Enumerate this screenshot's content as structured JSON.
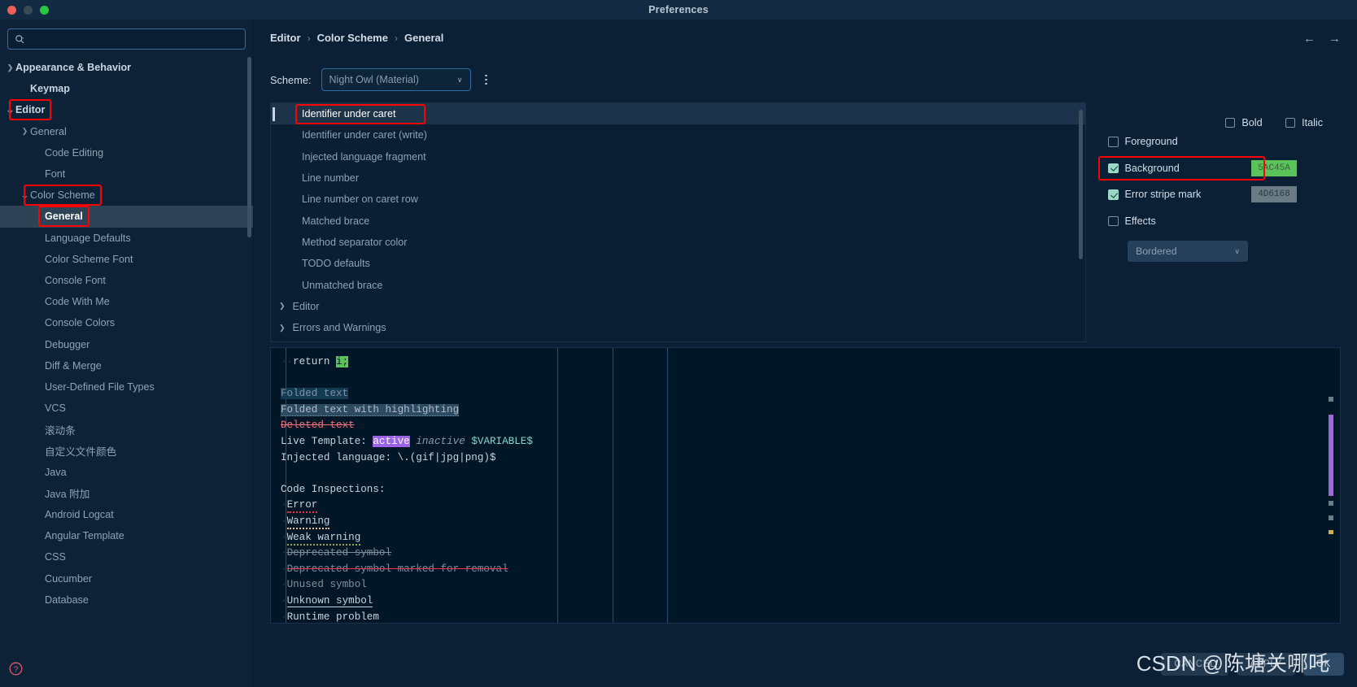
{
  "window": {
    "title": "Preferences",
    "traffic_lights": [
      "close",
      "minimize",
      "zoom"
    ]
  },
  "sidebar": {
    "search": {
      "value": "",
      "placeholder": ""
    },
    "items": [
      {
        "label": "Appearance & Behavior",
        "indent": 0,
        "chevron": "collapsed",
        "bold": true
      },
      {
        "label": "Keymap",
        "indent": 1,
        "chevron": "none",
        "bold": true
      },
      {
        "label": "Editor",
        "indent": 0,
        "chevron": "expanded",
        "bold": true,
        "annotated": true
      },
      {
        "label": "General",
        "indent": 1,
        "chevron": "collapsed",
        "bold": false
      },
      {
        "label": "Code Editing",
        "indent": 2,
        "chevron": "none",
        "bold": false
      },
      {
        "label": "Font",
        "indent": 2,
        "chevron": "none",
        "bold": false
      },
      {
        "label": "Color Scheme",
        "indent": 1,
        "chevron": "expanded",
        "bold": false,
        "annotated": true
      },
      {
        "label": "General",
        "indent": 2,
        "chevron": "none",
        "bold": false,
        "selected": true,
        "annotated": true
      },
      {
        "label": "Language Defaults",
        "indent": 2,
        "chevron": "none",
        "bold": false
      },
      {
        "label": "Color Scheme Font",
        "indent": 2,
        "chevron": "none",
        "bold": false
      },
      {
        "label": "Console Font",
        "indent": 2,
        "chevron": "none",
        "bold": false
      },
      {
        "label": "Code With Me",
        "indent": 2,
        "chevron": "none",
        "bold": false
      },
      {
        "label": "Console Colors",
        "indent": 2,
        "chevron": "none",
        "bold": false
      },
      {
        "label": "Debugger",
        "indent": 2,
        "chevron": "none",
        "bold": false
      },
      {
        "label": "Diff & Merge",
        "indent": 2,
        "chevron": "none",
        "bold": false
      },
      {
        "label": "User-Defined File Types",
        "indent": 2,
        "chevron": "none",
        "bold": false
      },
      {
        "label": "VCS",
        "indent": 2,
        "chevron": "none",
        "bold": false
      },
      {
        "label": "滚动条",
        "indent": 2,
        "chevron": "none",
        "bold": false
      },
      {
        "label": "自定义文件颜色",
        "indent": 2,
        "chevron": "none",
        "bold": false
      },
      {
        "label": "Java",
        "indent": 2,
        "chevron": "none",
        "bold": false
      },
      {
        "label": "Java 附加",
        "indent": 2,
        "chevron": "none",
        "bold": false
      },
      {
        "label": "Android Logcat",
        "indent": 2,
        "chevron": "none",
        "bold": false
      },
      {
        "label": "Angular Template",
        "indent": 2,
        "chevron": "none",
        "bold": false
      },
      {
        "label": "CSS",
        "indent": 2,
        "chevron": "none",
        "bold": false
      },
      {
        "label": "Cucumber",
        "indent": 2,
        "chevron": "none",
        "bold": false
      },
      {
        "label": "Database",
        "indent": 2,
        "chevron": "none",
        "bold": false
      }
    ]
  },
  "header": {
    "breadcrumb": [
      "Editor",
      "Color Scheme",
      "General"
    ],
    "separator": "›",
    "back_arrow": "←",
    "forward_arrow": "→"
  },
  "scheme": {
    "label": "Scheme:",
    "value": "Night Owl (Material)",
    "caret": "∨",
    "options_menu": "kebab-menu"
  },
  "attributes": {
    "items": [
      {
        "label": "Identifier under caret",
        "selected": true,
        "annotated": true
      },
      {
        "label": "Identifier under caret (write)",
        "selected": false
      },
      {
        "label": "Injected language fragment",
        "selected": false
      },
      {
        "label": "Line number",
        "selected": false
      },
      {
        "label": "Line number on caret row",
        "selected": false
      },
      {
        "label": "Matched brace",
        "selected": false
      },
      {
        "label": "Method separator color",
        "selected": false
      },
      {
        "label": "TODO defaults",
        "selected": false
      },
      {
        "label": "Unmatched brace",
        "selected": false
      }
    ],
    "groups": [
      {
        "label": "Editor",
        "chevron": "collapsed"
      },
      {
        "label": "Errors and Warnings",
        "chevron": "collapsed"
      }
    ]
  },
  "options": {
    "bold": {
      "label": "Bold",
      "checked": false
    },
    "italic": {
      "label": "Italic",
      "checked": false
    },
    "foreground": {
      "label": "Foreground",
      "checked": false,
      "color": ""
    },
    "background": {
      "label": "Background",
      "checked": true,
      "color": "5AC45A",
      "swatch_hex": "#5ac45a",
      "annotated": true
    },
    "error_stripe_mark": {
      "label": "Error stripe mark",
      "checked": true,
      "color": "4D6168",
      "swatch_hex": "#6b7b84"
    },
    "effects": {
      "label": "Effects",
      "checked": false,
      "value": "Bordered",
      "caret": "∨"
    }
  },
  "preview": {
    "lines": [
      {
        "id": "return",
        "text": "return i;"
      },
      {
        "id": "blank1",
        "text": ""
      },
      {
        "id": "folded",
        "text": "Folded text"
      },
      {
        "id": "folded-hl",
        "text": "Folded text with highlighting"
      },
      {
        "id": "deleted",
        "text": "Deleted text"
      },
      {
        "id": "live-template",
        "text": "Live Template: active inactive $VARIABLE$"
      },
      {
        "id": "injected",
        "text": "Injected language: \\.(gif|jpg|png)$"
      },
      {
        "id": "blank2",
        "text": ""
      },
      {
        "id": "inspections-header",
        "text": "Code Inspections:"
      },
      {
        "id": "error",
        "text": "Error"
      },
      {
        "id": "warning",
        "text": "Warning"
      },
      {
        "id": "weak-warning",
        "text": "Weak warning"
      },
      {
        "id": "deprecated",
        "text": "Deprecated symbol"
      },
      {
        "id": "deprecated-removal",
        "text": "Deprecated symbol marked for removal"
      },
      {
        "id": "unused",
        "text": "Unused symbol"
      },
      {
        "id": "unknown",
        "text": "Unknown symbol"
      },
      {
        "id": "runtime",
        "text": "Runtime problem"
      }
    ],
    "tokens": {
      "return_keyword": "return",
      "return_value": "i;",
      "lt_prefix": "Live Template: ",
      "lt_active": "active",
      "lt_inactive": "inactive",
      "lt_variable": "$VARIABLE$",
      "injected_label": "Injected language: ",
      "injected_value": "\\.(gif|jpg|png)$"
    }
  },
  "footer": {
    "cancel": "CANCEL",
    "apply": "APPLY",
    "ok": "OK"
  },
  "watermark": {
    "text": "CSDN @陈塘关哪吒"
  }
}
